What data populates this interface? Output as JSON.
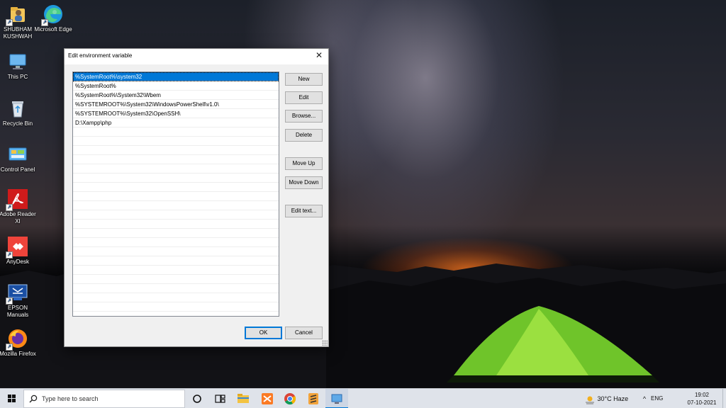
{
  "desktop": {
    "icons": [
      {
        "label": "SHUBHAM KUSHWAH",
        "icon": "user-folder-icon"
      },
      {
        "label": "Microsoft Edge",
        "icon": "edge-icon"
      },
      {
        "label": "This PC",
        "icon": "computer-icon"
      },
      {
        "label": "Recycle Bin",
        "icon": "recycle-bin-icon"
      },
      {
        "label": "Control Panel",
        "icon": "control-panel-icon"
      },
      {
        "label": "Adobe Reader XI",
        "icon": "adobe-reader-icon"
      },
      {
        "label": "AnyDesk",
        "icon": "anydesk-icon"
      },
      {
        "label": "EPSON Manuals",
        "icon": "epson-manuals-icon"
      },
      {
        "label": "Mozilla Firefox",
        "icon": "firefox-icon"
      }
    ]
  },
  "dialog": {
    "title": "Edit environment variable",
    "close_glyph": "✕",
    "paths": [
      "%SystemRoot%\\system32",
      "%SystemRoot%",
      "%SystemRoot%\\System32\\Wbem",
      "%SYSTEMROOT%\\System32\\WindowsPowerShell\\v1.0\\",
      "%SYSTEMROOT%\\System32\\OpenSSH\\",
      "D:\\Xampp\\php"
    ],
    "selected_index": 0,
    "buttons": {
      "new": "New",
      "edit": "Edit",
      "browse": "Browse...",
      "delete": "Delete",
      "move_up": "Move Up",
      "move_down": "Move Down",
      "edit_text": "Edit text...",
      "ok": "OK",
      "cancel": "Cancel"
    }
  },
  "taskbar": {
    "search_placeholder": "Type here to search",
    "apps": [
      "cortana-icon",
      "task-view-icon",
      "file-explorer-icon",
      "xampp-icon",
      "chrome-icon",
      "sublime-text-icon",
      "system-properties-icon"
    ],
    "weather": "30°C  Haze",
    "language": "ENG",
    "time": "19:02",
    "date": "07-10-2021"
  },
  "colors": {
    "selection": "#0078d7",
    "taskbar": "#dfe3ea",
    "dialog_bg": "#f0f0f0"
  }
}
